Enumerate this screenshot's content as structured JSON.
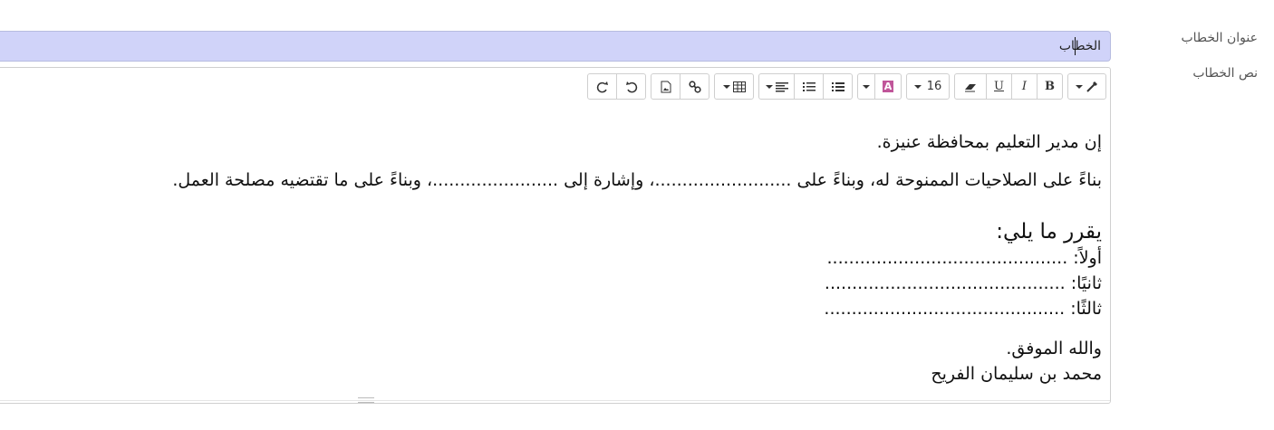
{
  "form": {
    "title_label": "عنوان الخطاب",
    "body_label": "نص الخطاب",
    "title_value": "الخطاب"
  },
  "toolbar": {
    "font_size": "16",
    "bold": "B",
    "italic": "I",
    "underline": "U",
    "color_glyph": "A",
    "icons": [
      "style-icon",
      "bold-icon",
      "italic-icon",
      "underline-icon",
      "eraser-icon",
      "font-size-icon",
      "font-color-icon",
      "unordered-list-icon",
      "ordered-list-icon",
      "paragraph-align-icon",
      "table-icon",
      "link-icon",
      "image-icon",
      "undo-icon",
      "redo-icon"
    ]
  },
  "letter": {
    "line1": "إن مدير التعليم بمحافظة عنيزة.",
    "line2": "بناءً على الصلاحيات الممنوحة له، وبناءً على .........................، وإشارة إلى .......................، وبناءً على ما تقتضيه مصلحة العمل.",
    "decides": "يقرر ما يلي:",
    "item1": "أولاً: ............................................",
    "item2": "ثانيًا: ............................................",
    "item3": "ثالثًا: ............................................",
    "closing": "والله الموفق.",
    "signature": "محمد بن سليمان الفريح"
  }
}
